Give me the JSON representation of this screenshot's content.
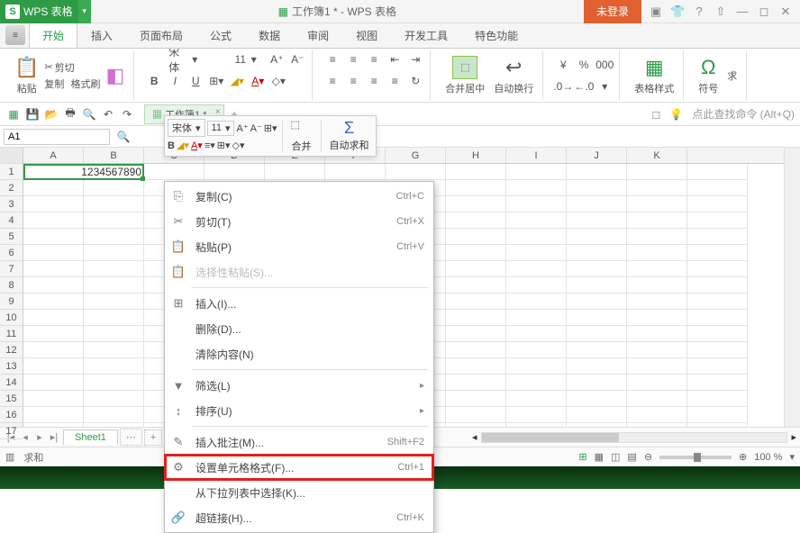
{
  "app": {
    "name": "WPS 表格",
    "doc_title": "工作簿1 * - WPS 表格",
    "login": "未登录"
  },
  "tabs": {
    "active": "开始",
    "items": [
      "开始",
      "插入",
      "页面布局",
      "公式",
      "数据",
      "审阅",
      "视图",
      "开发工具",
      "特色功能"
    ]
  },
  "ribbon": {
    "paste": "粘贴",
    "cut": "剪切",
    "copy": "复制",
    "format_painter": "格式刷",
    "font_name": "宋体",
    "font_size": "11",
    "merge_center": "合并居中",
    "wrap": "自动换行",
    "table_style": "表格样式",
    "symbol": "符号",
    "sum": "求"
  },
  "qat": {
    "doc_tab": "工作簿1 *",
    "search_hint": "点此查找命令 (Alt+Q)"
  },
  "mini": {
    "font_name": "宋体",
    "font_size": "11",
    "merge": "合并",
    "autosum": "自动求和"
  },
  "namebox": "A1",
  "columns": [
    "A",
    "B",
    "C",
    "D",
    "E",
    "F",
    "G",
    "H",
    "I",
    "J",
    "K"
  ],
  "rows": [
    "1",
    "2",
    "3",
    "4",
    "5",
    "6",
    "7",
    "8",
    "9",
    "10",
    "11",
    "12",
    "13",
    "14",
    "15",
    "16",
    "17"
  ],
  "cell_value": "1234567890",
  "context_menu": [
    {
      "icon": "⎘",
      "label": "复制(C)",
      "shortcut": "Ctrl+C"
    },
    {
      "icon": "✂",
      "label": "剪切(T)",
      "shortcut": "Ctrl+X"
    },
    {
      "icon": "📋",
      "label": "粘贴(P)",
      "shortcut": "Ctrl+V"
    },
    {
      "icon": "📋",
      "label": "选择性粘贴(S)...",
      "shortcut": "",
      "disabled": true
    },
    {
      "sep": true
    },
    {
      "icon": "⊞",
      "label": "插入(I)...",
      "shortcut": ""
    },
    {
      "icon": "",
      "label": "删除(D)...",
      "shortcut": ""
    },
    {
      "icon": "",
      "label": "清除内容(N)",
      "shortcut": ""
    },
    {
      "sep": true
    },
    {
      "icon": "▼",
      "label": "筛选(L)",
      "shortcut": "",
      "submenu": true
    },
    {
      "icon": "↕",
      "label": "排序(U)",
      "shortcut": "",
      "submenu": true
    },
    {
      "sep": true
    },
    {
      "icon": "✎",
      "label": "插入批注(M)...",
      "shortcut": "Shift+F2"
    },
    {
      "icon": "⚙",
      "label": "设置单元格格式(F)...",
      "shortcut": "Ctrl+1",
      "highlight": true
    },
    {
      "icon": "",
      "label": "从下拉列表中选择(K)...",
      "shortcut": ""
    },
    {
      "icon": "🔗",
      "label": "超链接(H)...",
      "shortcut": "Ctrl+K"
    }
  ],
  "sheet_tabs": {
    "active": "Sheet1",
    "more": "⋯",
    "add": "+"
  },
  "statusbar": {
    "sum_label": "求和",
    "zoom": "100 %"
  }
}
